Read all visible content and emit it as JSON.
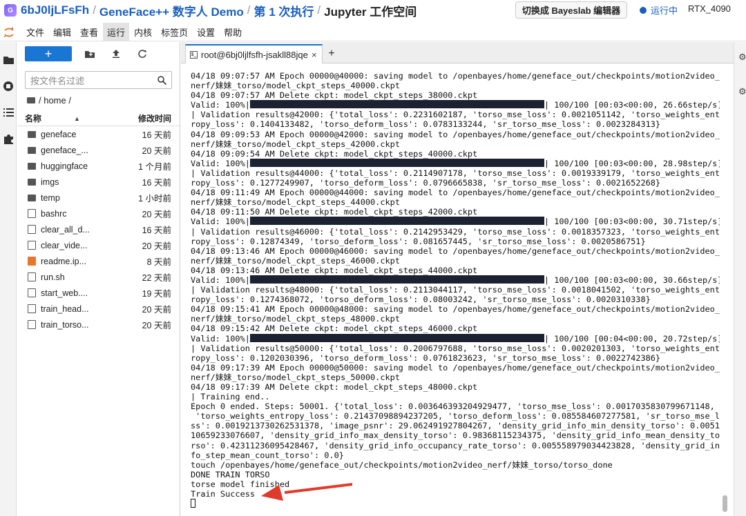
{
  "header": {
    "logo_text": "G",
    "crumbs": [
      "6bJ0ljLFsFh",
      "GeneFace++ 数字人 Demo",
      "第 1 次执行",
      "Jupyter 工作空间"
    ],
    "separator": "/",
    "switch_button": "切换成 Bayeslab 编辑器",
    "status_label": "运行中",
    "gpu_label": "RTX_4090",
    "status_color": "#1a5fc0"
  },
  "menu": {
    "items": [
      "文件",
      "编辑",
      "查看",
      "运行",
      "内核",
      "标签页",
      "设置",
      "帮助"
    ],
    "active": "运行"
  },
  "file_browser": {
    "new_button": "+",
    "filter_placeholder": "按文件名过滤",
    "path": "/ home /",
    "col_name": "名称",
    "col_modified": "修改时间",
    "files": [
      {
        "name": "geneface",
        "type": "folder",
        "modified": "16 天前"
      },
      {
        "name": "geneface_...",
        "type": "folder",
        "modified": "20 天前"
      },
      {
        "name": "huggingface",
        "type": "folder",
        "modified": "1 个月前"
      },
      {
        "name": "imgs",
        "type": "folder",
        "modified": "16 天前"
      },
      {
        "name": "temp",
        "type": "folder",
        "modified": "1 小时前"
      },
      {
        "name": "bashrc",
        "type": "file",
        "modified": "20 天前"
      },
      {
        "name": "clear_all_d...",
        "type": "file",
        "modified": "16 天前"
      },
      {
        "name": "clear_vide...",
        "type": "file",
        "modified": "20 天前"
      },
      {
        "name": "readme.ip...",
        "type": "notebook",
        "modified": "8 天前"
      },
      {
        "name": "run.sh",
        "type": "file",
        "modified": "22 天前"
      },
      {
        "name": "start_web....",
        "type": "file",
        "modified": "19 天前"
      },
      {
        "name": "train_head...",
        "type": "file",
        "modified": "20 天前"
      },
      {
        "name": "train_torso...",
        "type": "file",
        "modified": "20 天前"
      }
    ]
  },
  "tab": {
    "label": "root@6bj0ljlfsfh-jsakll88jqe",
    "close": "×",
    "add": "+"
  },
  "terminal": {
    "lines": [
      {
        "t": "04/18 09:07:57 AM Epoch 00000@40000: saving model to /openbayes/home/geneface_out/checkpoints/motion2video_"
      },
      {
        "t": "nerf/妹妹_torso/model_ckpt_steps_40000.ckpt"
      },
      {
        "t": "04/18 09:07:57 AM Delete ckpt: model_ckpt_steps_38000.ckpt"
      },
      {
        "pre": "Valid: 100%|",
        "bar": true,
        "post": "| 100/100 [00:03<00:00, 26.66step/s]"
      },
      {
        "t": "| Validation results@42000: {'total_loss': 0.2231602187, 'torso_mse_loss': 0.0021051142, 'torso_weights_ent"
      },
      {
        "t": "ropy_loss': 0.1404133482, 'torso_deform_loss': 0.0783133244, 'sr_torso_mse_loss': 0.0023284313}"
      },
      {
        "t": "04/18 09:09:53 AM Epoch 00000@42000: saving model to /openbayes/home/geneface_out/checkpoints/motion2video_"
      },
      {
        "t": "nerf/妹妹_torso/model_ckpt_steps_42000.ckpt"
      },
      {
        "t": "04/18 09:09:54 AM Delete ckpt: model_ckpt_steps_40000.ckpt"
      },
      {
        "pre": "Valid: 100%|",
        "bar": true,
        "post": "| 100/100 [00:03<00:00, 28.98step/s]"
      },
      {
        "t": "| Validation results@44000: {'total_loss': 0.2114907178, 'torso_mse_loss': 0.0019339179, 'torso_weights_ent"
      },
      {
        "t": "ropy_loss': 0.1277249907, 'torso_deform_loss': 0.0796665838, 'sr_torso_mse_loss': 0.0021652268}"
      },
      {
        "t": "04/18 09:11:49 AM Epoch 00000@44000: saving model to /openbayes/home/geneface_out/checkpoints/motion2video_"
      },
      {
        "t": "nerf/妹妹_torso/model_ckpt_steps_44000.ckpt"
      },
      {
        "t": "04/18 09:11:50 AM Delete ckpt: model_ckpt_steps_42000.ckpt"
      },
      {
        "pre": "Valid: 100%|",
        "bar": true,
        "post": "| 100/100 [00:03<00:00, 30.71step/s]"
      },
      {
        "t": "| Validation results@46000: {'total_loss': 0.2142953429, 'torso_mse_loss': 0.0018357323, 'torso_weights_ent"
      },
      {
        "t": "ropy_loss': 0.12874349, 'torso_deform_loss': 0.081657445, 'sr_torso_mse_loss': 0.0020586751}"
      },
      {
        "t": "04/18 09:13:46 AM Epoch 00000@46000: saving model to /openbayes/home/geneface_out/checkpoints/motion2video_"
      },
      {
        "t": "nerf/妹妹_torso/model_ckpt_steps_46000.ckpt"
      },
      {
        "t": "04/18 09:13:46 AM Delete ckpt: model_ckpt_steps_44000.ckpt"
      },
      {
        "pre": "Valid: 100%|",
        "bar": true,
        "post": "| 100/100 [00:03<00:00, 30.66step/s]"
      },
      {
        "t": "| Validation results@48000: {'total_loss': 0.2113044117, 'torso_mse_loss': 0.0018041502, 'torso_weights_ent"
      },
      {
        "t": "ropy_loss': 0.1274368072, 'torso_deform_loss': 0.08003242, 'sr_torso_mse_loss': 0.0020310338}"
      },
      {
        "t": "04/18 09:15:41 AM Epoch 00000@48000: saving model to /openbayes/home/geneface_out/checkpoints/motion2video_"
      },
      {
        "t": "nerf/妹妹_torso/model_ckpt_steps_48000.ckpt"
      },
      {
        "t": "04/18 09:15:42 AM Delete ckpt: model_ckpt_steps_46000.ckpt"
      },
      {
        "pre": "Valid: 100%|",
        "bar": true,
        "post": "| 100/100 [00:04<00:00, 20.72step/s]"
      },
      {
        "t": "| Validation results@50000: {'total_loss': 0.2006797688, 'torso_mse_loss': 0.0020201303, 'torso_weights_ent"
      },
      {
        "t": "ropy_loss': 0.1202030396, 'torso_deform_loss': 0.0761823623, 'sr_torso_mse_loss': 0.0022742386}"
      },
      {
        "t": "04/18 09:17:39 AM Epoch 00000@50000: saving model to /openbayes/home/geneface_out/checkpoints/motion2video_"
      },
      {
        "t": "nerf/妹妹_torso/model_ckpt_steps_50000.ckpt"
      },
      {
        "t": "04/18 09:17:39 AM Delete ckpt: model_ckpt_steps_48000.ckpt"
      },
      {
        "t": "| Training end.."
      },
      {
        "t": "Epoch 0 ended. Steps: 50001. {'total_loss': 0.003646393204929477, 'torso_mse_loss': 0.0017035830799671148,"
      },
      {
        "t": " 'torso_weights_entropy_loss': 0.21437098894237205, 'torso_deform_loss': 0.085584607277581, 'sr_torso_mse_lo"
      },
      {
        "t": "ss': 0.0019213730262531378, 'image_psnr': 29.062491927804267, 'density_grid_info_min_density_torso': 0.0051"
      },
      {
        "t": "10659233076607, 'density_grid_info_max_density_torso': 0.98368115234375, 'density_grid_info_mean_density_to"
      },
      {
        "t": "rso': 0.42311236095428467, 'density_grid_info_occupancy_rate_torso': 0.005558979034423828, 'density_grid_in"
      },
      {
        "t": "fo_step_mean_count_torso': 0.0}"
      },
      {
        "t": "touch /openbayes/home/geneface_out/checkpoints/motion2video_nerf/妹妹_torso/torso_done"
      },
      {
        "t": "DONE TRAIN TORSO"
      },
      {
        "t": "torse model finished"
      },
      {
        "t": "Train Success"
      }
    ]
  },
  "annotation_arrow_color": "#e03a2a"
}
